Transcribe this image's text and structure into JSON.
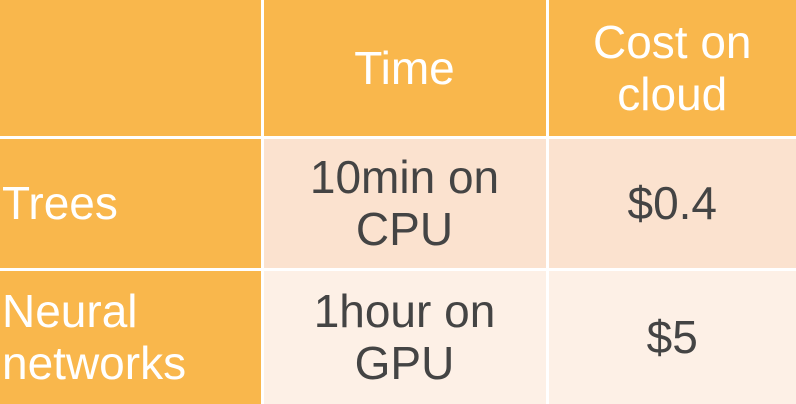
{
  "table": {
    "headers": [
      "",
      "Time",
      "Cost on\ncloud"
    ],
    "rows": [
      {
        "label": "Trees",
        "time": "10min on\nCPU",
        "cost": "$0.4"
      },
      {
        "label": "Neural\nnetworks",
        "time": "1hour on\nGPU",
        "cost": "$5"
      }
    ]
  },
  "colors": {
    "header_bg": "#f9b74c",
    "row1_bg": "#fbe2cf",
    "row2_bg": "#fdf0e6",
    "text_dark": "#444444",
    "text_light": "#ffffff"
  }
}
